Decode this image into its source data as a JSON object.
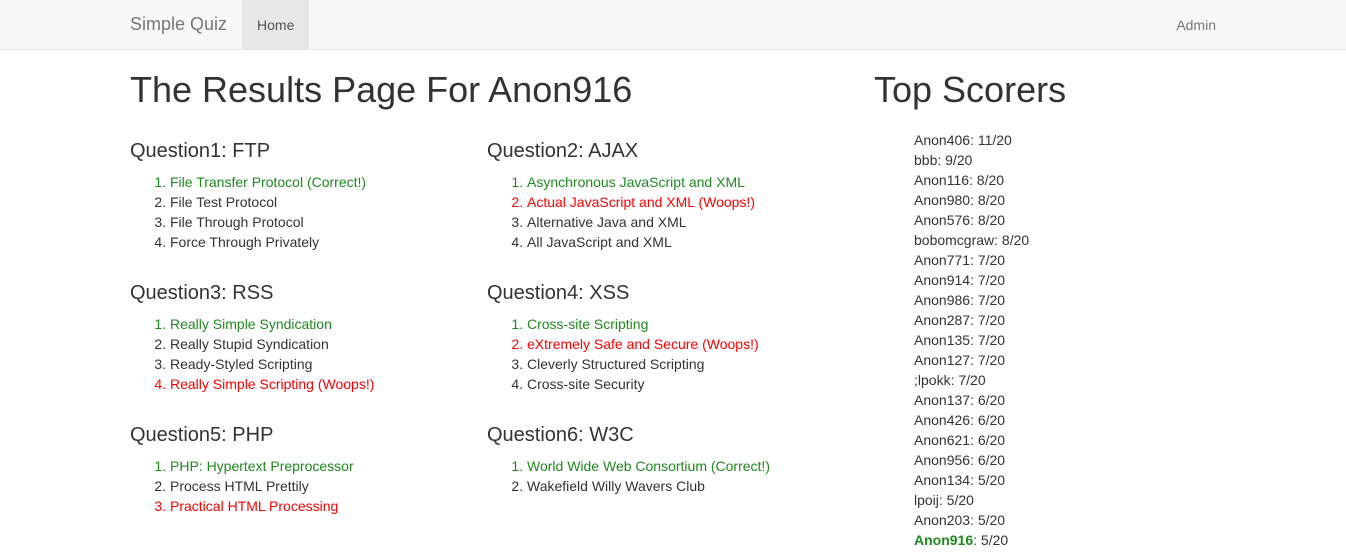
{
  "navbar": {
    "brand": "Simple Quiz",
    "left_items": [
      {
        "label": "Home",
        "active": true
      }
    ],
    "right_items": [
      {
        "label": "Admin",
        "active": false
      }
    ]
  },
  "results": {
    "page_title": "The Results Page For Anon916",
    "questions": [
      {
        "title": "Question1: FTP",
        "answers": [
          {
            "text": "File Transfer Protocol (Correct!)",
            "state": "correct"
          },
          {
            "text": "File Test Protocol",
            "state": "none"
          },
          {
            "text": "File Through Protocol",
            "state": "none"
          },
          {
            "text": "Force Through Privately",
            "state": "none"
          }
        ]
      },
      {
        "title": "Question2: AJAX",
        "answers": [
          {
            "text": "Asynchronous JavaScript and XML",
            "state": "correct"
          },
          {
            "text": "Actual JavaScript and XML (Woops!)",
            "state": "wrong"
          },
          {
            "text": "Alternative Java and XML",
            "state": "none"
          },
          {
            "text": "All JavaScript and XML",
            "state": "none"
          }
        ]
      },
      {
        "title": "Question3: RSS",
        "answers": [
          {
            "text": "Really Simple Syndication",
            "state": "correct"
          },
          {
            "text": "Really Stupid Syndication",
            "state": "none"
          },
          {
            "text": "Ready-Styled Scripting",
            "state": "none"
          },
          {
            "text": "Really Simple Scripting (Woops!)",
            "state": "wrong"
          }
        ]
      },
      {
        "title": "Question4: XSS",
        "answers": [
          {
            "text": "Cross-site Scripting",
            "state": "correct"
          },
          {
            "text": "eXtremely Safe and Secure (Woops!)",
            "state": "wrong"
          },
          {
            "text": "Cleverly Structured Scripting",
            "state": "none"
          },
          {
            "text": "Cross-site Security",
            "state": "none"
          }
        ]
      },
      {
        "title": "Question5: PHP",
        "answers": [
          {
            "text": "PHP: Hypertext Preprocessor",
            "state": "correct"
          },
          {
            "text": "Process HTML Prettily",
            "state": "none"
          },
          {
            "text": "Practical HTML Processing",
            "state": "wrong"
          }
        ]
      },
      {
        "title": "Question6: W3C",
        "answers": [
          {
            "text": "World Wide Web Consortium (Correct!)",
            "state": "correct"
          },
          {
            "text": "Wakefield Willy Wavers Club",
            "state": "none"
          }
        ]
      }
    ]
  },
  "top_scorers": {
    "title": "Top Scorers",
    "entries": [
      {
        "name": "Anon406",
        "score": ": 11/20",
        "highlight": false
      },
      {
        "name": "bbb",
        "score": ": 9/20",
        "highlight": false
      },
      {
        "name": "Anon116",
        "score": ": 8/20",
        "highlight": false
      },
      {
        "name": "Anon980",
        "score": ": 8/20",
        "highlight": false
      },
      {
        "name": "Anon576",
        "score": ": 8/20",
        "highlight": false
      },
      {
        "name": "bobomcgraw",
        "score": ": 8/20",
        "highlight": false
      },
      {
        "name": "Anon771",
        "score": ": 7/20",
        "highlight": false
      },
      {
        "name": "Anon914",
        "score": ": 7/20",
        "highlight": false
      },
      {
        "name": "Anon986",
        "score": ": 7/20",
        "highlight": false
      },
      {
        "name": "Anon287",
        "score": ": 7/20",
        "highlight": false
      },
      {
        "name": "Anon135",
        "score": ": 7/20",
        "highlight": false
      },
      {
        "name": "Anon127",
        "score": ": 7/20",
        "highlight": false
      },
      {
        "name": ";lpokk",
        "score": ": 7/20",
        "highlight": false
      },
      {
        "name": "Anon137",
        "score": ": 6/20",
        "highlight": false
      },
      {
        "name": "Anon426",
        "score": ": 6/20",
        "highlight": false
      },
      {
        "name": "Anon621",
        "score": ": 6/20",
        "highlight": false
      },
      {
        "name": "Anon956",
        "score": ": 6/20",
        "highlight": false
      },
      {
        "name": "Anon134",
        "score": ": 5/20",
        "highlight": false
      },
      {
        "name": "lpoij",
        "score": ": 5/20",
        "highlight": false
      },
      {
        "name": "Anon203",
        "score": ": 5/20",
        "highlight": false
      },
      {
        "name": "Anon916",
        "score": ": 5/20",
        "highlight": true
      }
    ]
  },
  "colors": {
    "correct": "#1e8a1e",
    "wrong": "#fe0000",
    "navbar_bg": "#f8f8f8",
    "navbar_active_bg": "#e7e7e7",
    "text": "#333333",
    "muted": "#777777"
  }
}
